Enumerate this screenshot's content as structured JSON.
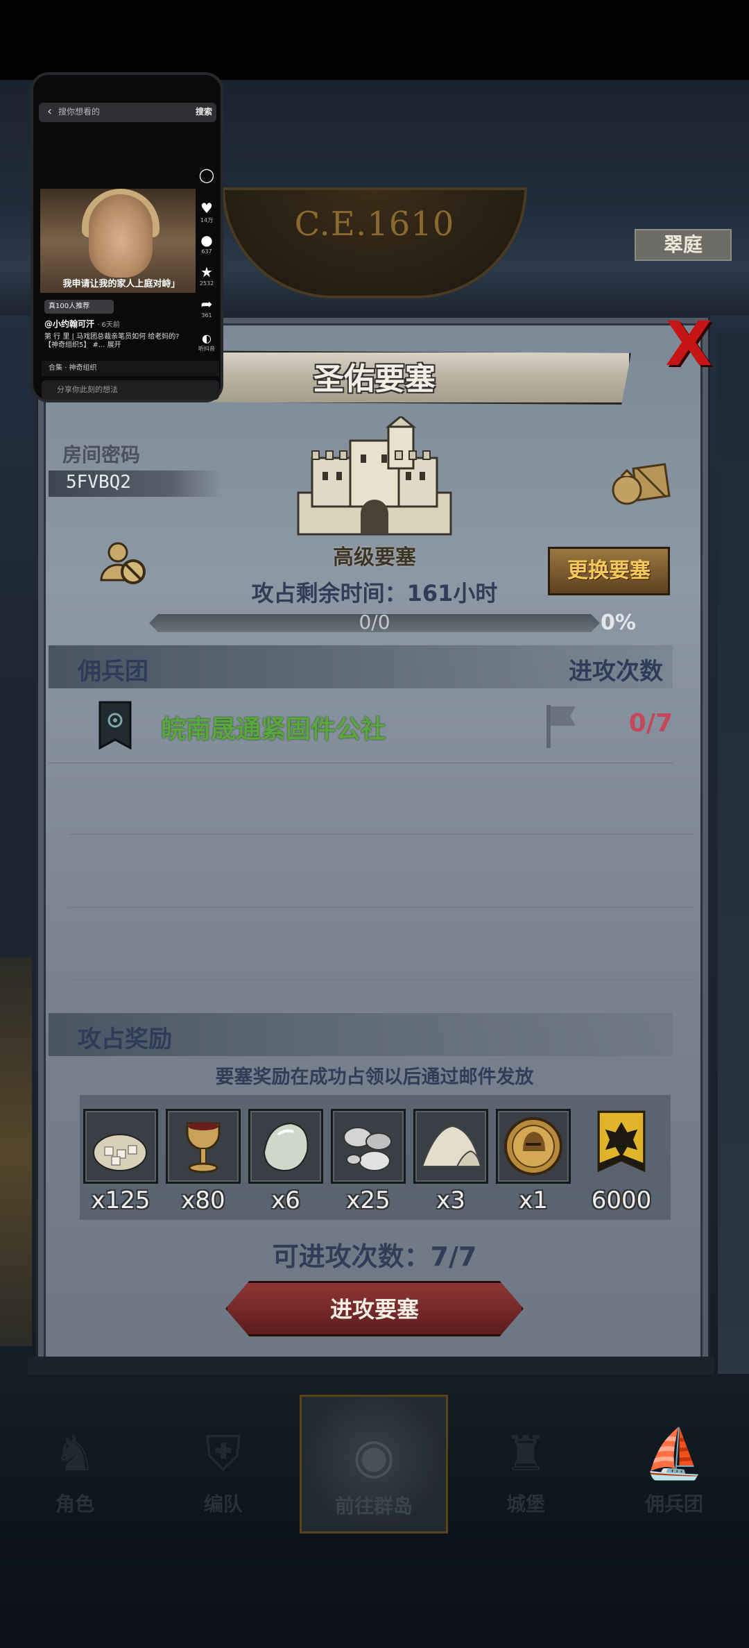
{
  "game": {
    "era": "C.E.1610",
    "top_tag": "翠庭",
    "title": "圣佑要塞",
    "close_label": "X",
    "room_label": "房间密码",
    "room_code": "5FVBQ2",
    "fortress_level": "高级要塞",
    "change_button": "更换要塞",
    "time_left": "攻占剩余时间：161小时",
    "progress_text": "0/0",
    "progress_fraction": 0.0,
    "progress_pct": "0%",
    "guild_header": "佣兵团",
    "attacks_header": "进攻次数",
    "guild": {
      "name": "皖南晟通紧固件公社",
      "attacks": "0/7"
    },
    "reward_header": "攻占奖励",
    "reward_note": "要塞奖励在成功占领以后通过邮件发放",
    "rewards": [
      {
        "icon": "sugar-sack-icon",
        "count": "x125"
      },
      {
        "icon": "goblet-icon",
        "count": "x80"
      },
      {
        "icon": "gem-stone-icon",
        "count": "x6"
      },
      {
        "icon": "silver-pebbles-icon",
        "count": "x25"
      },
      {
        "icon": "salt-pile-icon",
        "count": "x3"
      },
      {
        "icon": "knight-coin-icon",
        "count": "x1"
      },
      {
        "icon": "guild-emblem-icon",
        "count": "6000"
      }
    ],
    "attacks_left": "可进攻次数：7/7",
    "attack_button": "进攻要塞",
    "nav": [
      "角色",
      "编队",
      "前往群岛",
      "城堡",
      "佣兵团"
    ],
    "colors": {
      "guild_name": "#5aa83d",
      "attack_count": "#c5475a",
      "change_button_text": "#f5c85a",
      "close_x": "#c61515"
    }
  },
  "mini_player": {
    "search_placeholder": "搜你想看的",
    "search_button": "搜索",
    "caption": "我申请让我的家人上庭对峙」",
    "likes": "14万",
    "comments": "637",
    "favorites": "2532",
    "shares": "361",
    "chip": "真100人推荐",
    "author": "@小约翰可汗",
    "time": "· 6天前",
    "desc": "第 行 里 | 马戏团总裁亲笔员如何 给老妈的?【神奇组织5】 #... 展开",
    "music": "合集 · 神奇组织",
    "comment_placeholder": "分享你此刻的想法",
    "listen_label": "听抖音"
  }
}
